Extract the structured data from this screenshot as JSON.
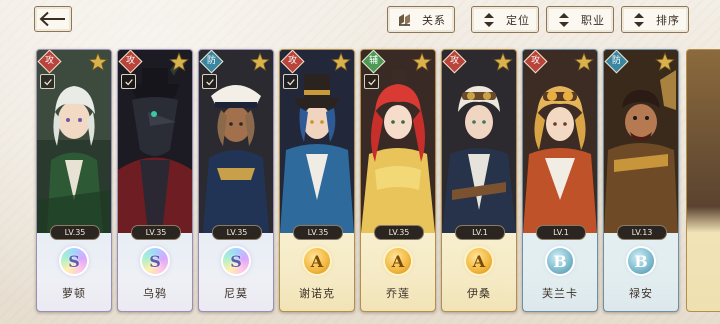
{
  "toolbar": {
    "back_icon": "back-arrow-icon",
    "buttons": [
      {
        "label": "关系",
        "icon": "relation-icon"
      },
      {
        "label": "定位",
        "icon": "sort-arrows-icon"
      },
      {
        "label": "职业",
        "icon": "sort-arrows-icon"
      },
      {
        "label": "排序",
        "icon": "sort-arrows-icon"
      }
    ]
  },
  "characters": [
    {
      "name": "萝顿",
      "level": "LV.35",
      "rank": "S",
      "role": "攻",
      "role_color": "#b8443c"
    },
    {
      "name": "乌鸦",
      "level": "LV.35",
      "rank": "S",
      "role": "攻",
      "role_color": "#b8443c"
    },
    {
      "name": "尼莫",
      "level": "LV.35",
      "rank": "S",
      "role": "防",
      "role_color": "#3b86a0"
    },
    {
      "name": "谢诺克",
      "level": "LV.35",
      "rank": "A",
      "role": "攻",
      "role_color": "#b8443c"
    },
    {
      "name": "乔莲",
      "level": "LV.35",
      "rank": "A",
      "role": "辅",
      "role_color": "#4d9a56"
    },
    {
      "name": "伊桑",
      "level": "LV.1",
      "rank": "A",
      "role": "攻",
      "role_color": "#b8443c"
    },
    {
      "name": "芙兰卡",
      "level": "LV.1",
      "rank": "B",
      "role": "攻",
      "role_color": "#b8443c"
    },
    {
      "name": "禄安",
      "level": "LV.13",
      "rank": "B",
      "role": "防",
      "role_color": "#3b86a0"
    }
  ],
  "colors": {
    "rank_s": "#9a8fb4",
    "rank_a": "#f2b63c",
    "rank_b": "#7ab8cc",
    "button_border": "#8d7557"
  }
}
